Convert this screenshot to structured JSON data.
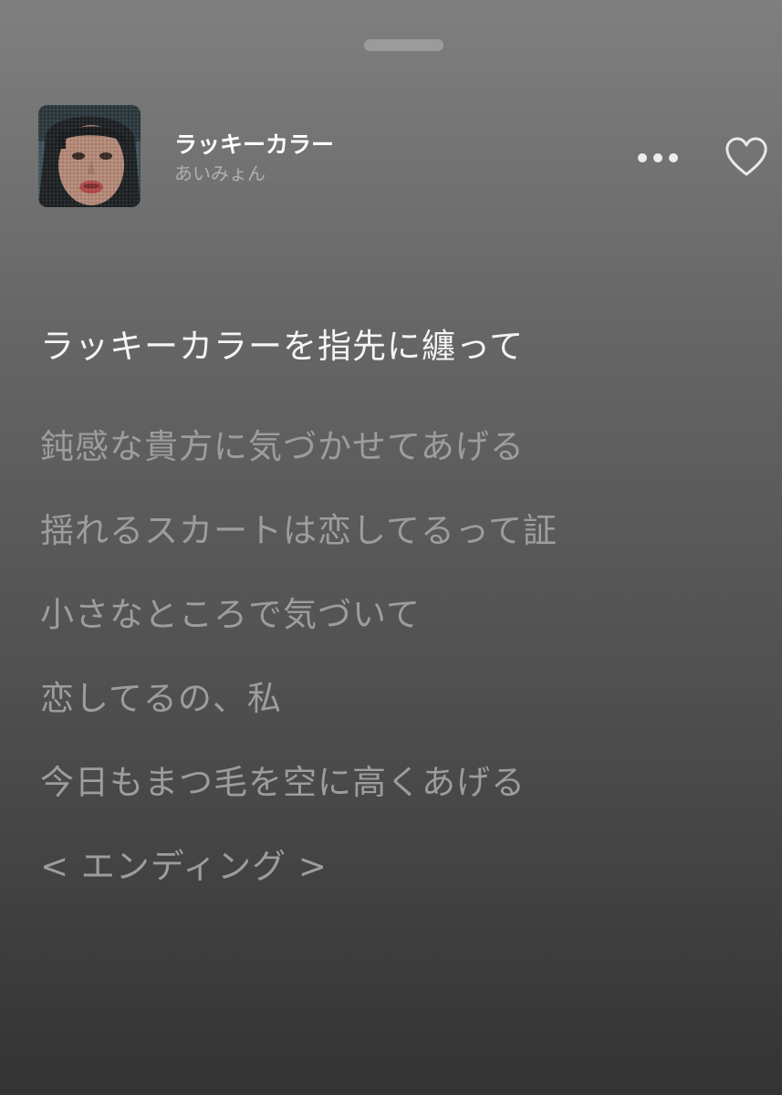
{
  "track": {
    "title": "ラッキーカラー",
    "artist": "あいみょん"
  },
  "icons": {
    "more": "more-horizontal-icon",
    "like": "heart-outline-icon"
  },
  "colors": {
    "current_lyric": "#f4f4f4",
    "upcoming_lyric": "#9d9d9d",
    "title": "#ffffff",
    "artist": "#b0b0b0"
  },
  "lyrics": {
    "current": "ラッキーカラーを指先に纏って",
    "upcoming": [
      "鈍感な貴方に気づかせてあげる",
      "揺れるスカートは恋してるって証",
      "小さなところで気づいて",
      "恋してるの、私",
      "今日もまつ毛を空に高くあげる",
      "< エンディング >"
    ]
  }
}
